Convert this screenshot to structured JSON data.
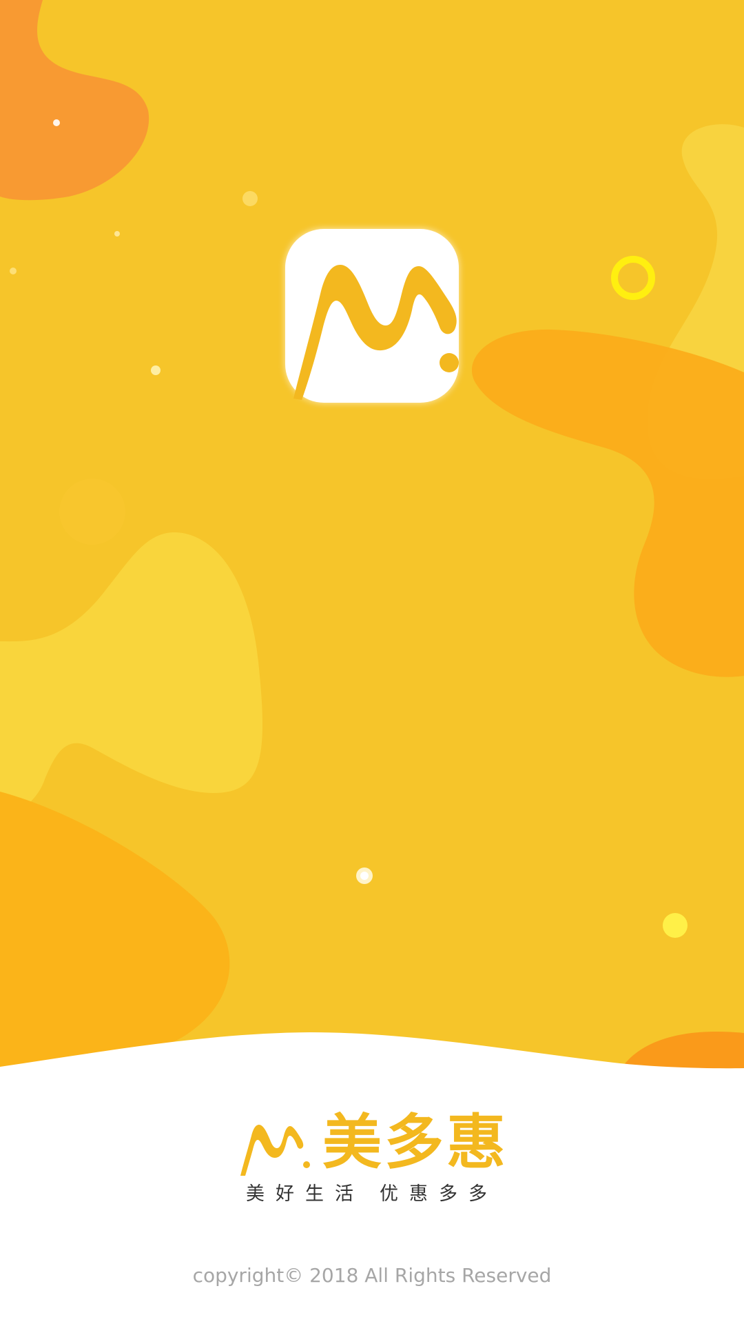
{
  "app": {
    "icon_name": "m-logo-icon",
    "brand_name": "美多惠",
    "slogan_left": "美好生活",
    "slogan_right": "优惠多多",
    "copyright": "copyright© 2018 All  Rights Reserved"
  },
  "colors": {
    "background": "#f6c52a",
    "accent_orange": "#f79a31",
    "accent_deep_orange": "#fbb01c",
    "accent_light_yellow": "#f8d43d",
    "brand_text": "#f3b81f",
    "footer_background": "#ffffff",
    "copyright_text": "#a6a6a6"
  }
}
